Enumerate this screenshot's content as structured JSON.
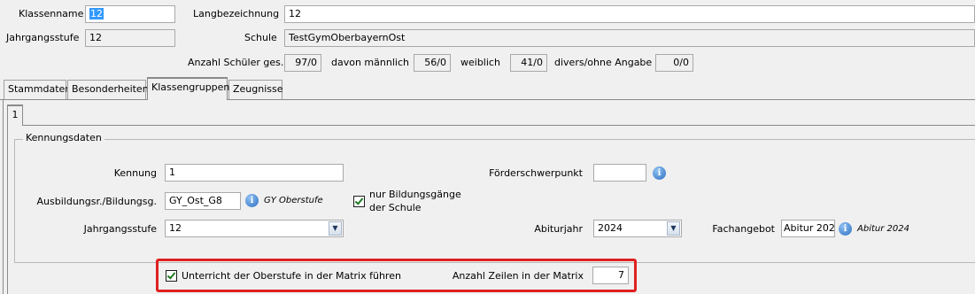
{
  "header": {
    "klassenname_label": "Klassenname",
    "klassenname_value": "12",
    "langbezeichnung_label": "Langbezeichnung",
    "langbezeichnung_value": "12",
    "jahrgangsstufe_label": "Jahrgangsstufe",
    "jahrgangsstufe_value": "12",
    "schule_label": "Schule",
    "schule_value": "TestGymOberbayernOst",
    "anzahl_label": "Anzahl Schüler ges.",
    "anzahl_value": "97/0",
    "maennlich_label": "davon männlich",
    "maennlich_value": "56/0",
    "weiblich_label": "weiblich",
    "weiblich_value": "41/0",
    "divers_label": "divers/ohne Angabe",
    "divers_value": "0/0"
  },
  "tabs": [
    {
      "label": "Stammdaten",
      "active": false
    },
    {
      "label": "Besonderheiten",
      "active": false
    },
    {
      "label": "Klassengruppen",
      "active": true
    },
    {
      "label": "Zeugnisse",
      "active": false
    }
  ],
  "subtab": {
    "label": "1"
  },
  "group": {
    "title": "Kennungsdaten",
    "kennung_label": "Kennung",
    "kennung_value": "1",
    "ausbildung_label": "Ausbildungsr./Bildungsg.",
    "ausbildung_value": "GY_Ost_G8",
    "ausbildung_hint": "GY Oberstufe",
    "nur_bildungsgaenge_line1": "nur Bildungsgänge",
    "nur_bildungsgaenge_line2": "der Schule",
    "nur_bildungsgaenge_checked": true,
    "jahrgangsstufe_label": "Jahrgangsstufe",
    "jahrgangsstufe_value": "12",
    "foerderschwerpunkt_label": "Förderschwerpunkt",
    "foerderschwerpunkt_value": "",
    "abiturjahr_label": "Abiturjahr",
    "abiturjahr_value": "2024",
    "fachangebot_label": "Fachangebot",
    "fachangebot_value": "Abitur 202",
    "fachangebot_hint": "Abitur 2024",
    "matrix_checkbox_label": "Unterricht der Oberstufe in der Matrix führen",
    "matrix_checked": true,
    "zeilen_label": "Anzahl Zeilen in der Matrix",
    "zeilen_value": "7"
  },
  "icons": {
    "info": "info-icon",
    "dropdown": "chevron-down-icon",
    "check": "check-icon"
  },
  "colors": {
    "highlight_border": "#e02020",
    "selection": "#3399ff",
    "active_tab_accent": "#f4a531"
  }
}
